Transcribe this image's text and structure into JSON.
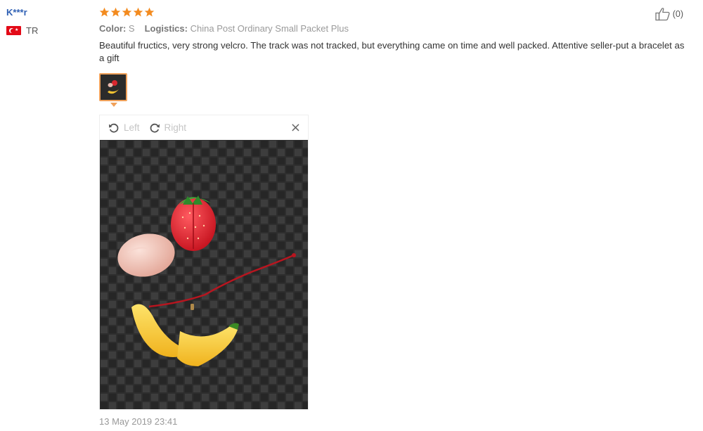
{
  "review": {
    "username": "K***r",
    "country_code": "TR",
    "flag_icon": "turkey-flag-icon",
    "rating": 5,
    "star_color": "#f38b1f",
    "meta": {
      "color_label": "Color:",
      "color_value": "S",
      "logistics_label": "Logistics:",
      "logistics_value": "China Post Ordinary Small Packet Plus"
    },
    "comment": "Beautiful fructics, very strong velcro. The track was not tracked, but everything came on time and well packed. Attentive seller-put a bracelet as a gift",
    "helpful_count": "(0)",
    "date": "13 May 2019 23:41"
  },
  "viewer": {
    "rotate_left_label": "Left",
    "rotate_right_label": "Right",
    "close_glyph": "×"
  }
}
